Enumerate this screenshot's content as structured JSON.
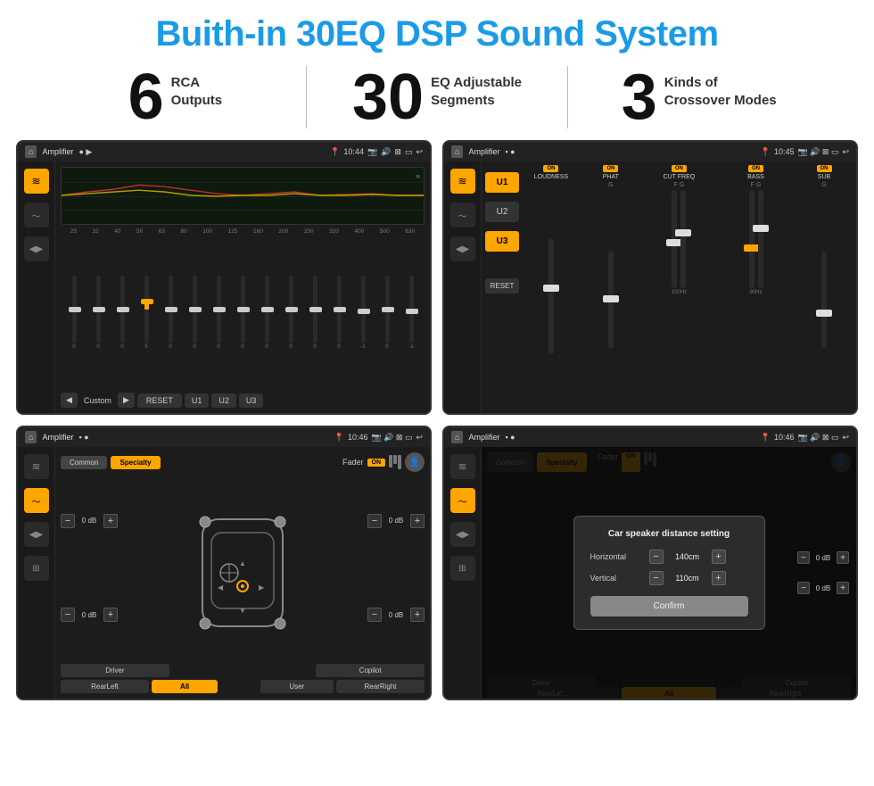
{
  "page": {
    "title": "Buith-in 30EQ DSP Sound System",
    "background": "#ffffff"
  },
  "stats": [
    {
      "number": "6",
      "label": "RCA\nOutputs"
    },
    {
      "number": "30",
      "label": "EQ Adjustable\nSegments"
    },
    {
      "number": "3",
      "label": "Kinds of\nCrossover Modes"
    }
  ],
  "screens": [
    {
      "id": "eq-screen",
      "title": "Amplifier",
      "time": "10:44",
      "type": "equalizer",
      "freqs": [
        "25",
        "32",
        "40",
        "50",
        "63",
        "80",
        "100",
        "125",
        "160",
        "200",
        "250",
        "320",
        "400",
        "500",
        "630"
      ],
      "values": [
        "0",
        "0",
        "0",
        "5",
        "0",
        "0",
        "0",
        "0",
        "0",
        "0",
        "0",
        "0",
        "-1",
        "0",
        "-1"
      ],
      "preset": "Custom",
      "buttons": [
        "RESET",
        "U1",
        "U2",
        "U3"
      ]
    },
    {
      "id": "crossover-screen",
      "title": "Amplifier",
      "time": "10:45",
      "type": "crossover",
      "channels": [
        "LOUDNESS",
        "PHAT",
        "CUT FREQ",
        "BASS",
        "SUB"
      ],
      "units": [
        "U1",
        "U2",
        "U3"
      ],
      "resetBtn": "RESET"
    },
    {
      "id": "fader-screen",
      "title": "Amplifier",
      "time": "10:46",
      "type": "fader",
      "tabs": [
        "Common",
        "Specialty"
      ],
      "faderLabel": "Fader",
      "faderOn": "ON",
      "speakerPositions": [
        {
          "label": "Driver",
          "pos": "bl"
        },
        {
          "label": "Copilot",
          "pos": "br"
        },
        {
          "label": "RearLeft",
          "pos": "tl"
        },
        {
          "label": "RearRight",
          "pos": "tr"
        }
      ],
      "volumeRows": [
        {
          "value": "0 dB"
        },
        {
          "value": "0 dB"
        },
        {
          "value": "0 dB"
        },
        {
          "value": "0 dB"
        }
      ],
      "bottomBtns": [
        "Driver",
        "All",
        "User",
        "RearRight",
        "Copilot",
        "RearLeft"
      ]
    },
    {
      "id": "dialog-screen",
      "title": "Amplifier",
      "time": "10:46",
      "type": "dialog",
      "tabs": [
        "Common",
        "Specialty"
      ],
      "dialogTitle": "Car speaker distance setting",
      "rows": [
        {
          "label": "Horizontal",
          "value": "140cm"
        },
        {
          "label": "Vertical",
          "value": "110cm"
        }
      ],
      "confirmBtn": "Confirm",
      "sideValues": [
        {
          "value": "0 dB"
        },
        {
          "value": "0 dB"
        }
      ]
    }
  ],
  "icons": {
    "home": "⌂",
    "location": "📍",
    "volume": "🔊",
    "back": "↩",
    "settings": "⚙",
    "music": "♪",
    "eq": "≋",
    "speaker": "▶",
    "fader": "⊞",
    "wifi": "wifi"
  }
}
